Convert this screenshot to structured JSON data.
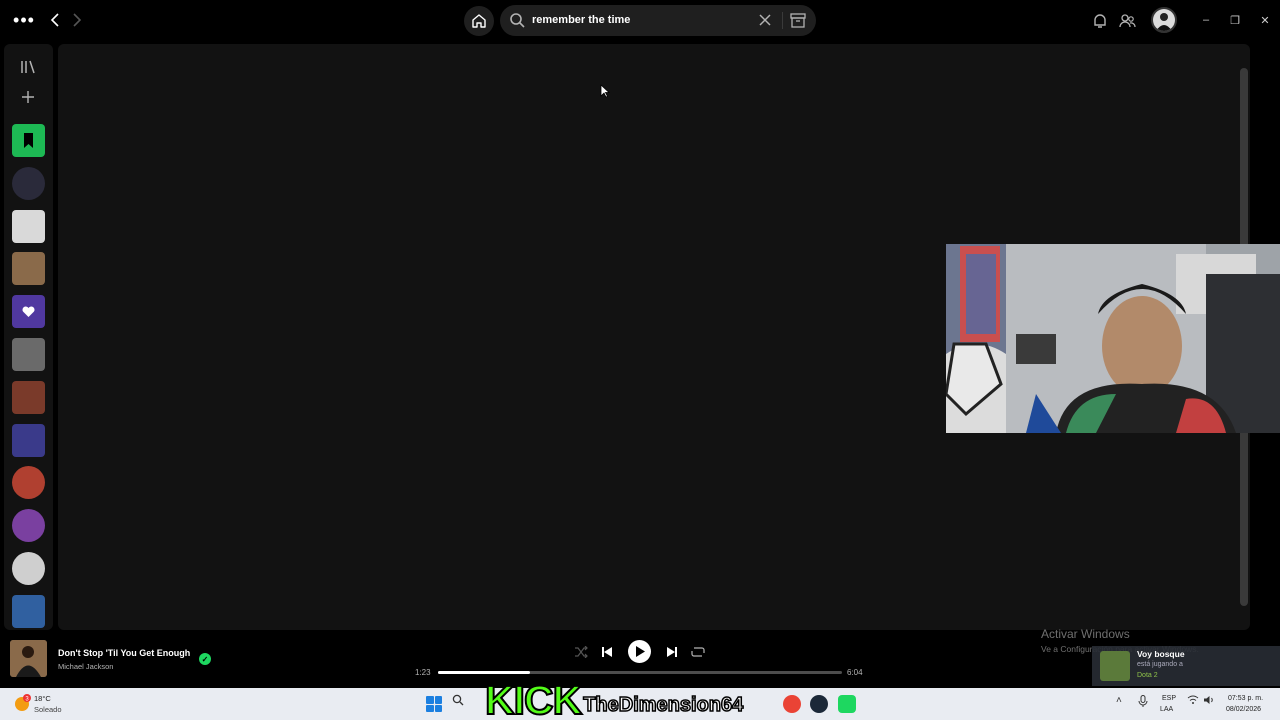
{
  "top_bar": {
    "menu_icon": "ellipsis-icon",
    "back_icon": "chevron-left-icon",
    "forward_icon": "chevron-right-icon",
    "home_icon": "home-icon",
    "search": {
      "value": "remember the time",
      "icon": "search-icon",
      "clear_icon": "close-icon",
      "browse_icon": "browse-icon"
    },
    "notifications_icon": "bell-icon",
    "friends_icon": "friends-icon",
    "window_controls": {
      "minimize": "–",
      "restore": "❐",
      "close": "✕"
    }
  },
  "sidebar": {
    "library_icon": "library-icon",
    "create_icon": "plus-icon",
    "items": [
      {
        "name": "saved-episodes",
        "color": "#1db954",
        "round": false
      },
      {
        "name": "artist-1",
        "color": "#2a2a3a",
        "round": true
      },
      {
        "name": "album-1",
        "color": "#d9d9d9",
        "round": false
      },
      {
        "name": "album-2",
        "color": "#8a6a4a",
        "round": false
      },
      {
        "name": "liked-songs",
        "color": "#5038a0",
        "round": false
      },
      {
        "name": "album-3",
        "color": "#6a6a6a",
        "round": false
      },
      {
        "name": "playlist-1",
        "color": "#7a3a2a",
        "round": false
      },
      {
        "name": "playlist-2",
        "color": "#3a3a8a",
        "round": false
      },
      {
        "name": "artist-2",
        "color": "#b04030",
        "round": true
      },
      {
        "name": "artist-3",
        "color": "#7a40a0",
        "round": true
      },
      {
        "name": "artist-4",
        "color": "#cfcfcf",
        "round": true
      },
      {
        "name": "playlist-3",
        "color": "#3060a0",
        "round": false
      }
    ]
  },
  "now_playing": {
    "title": "Don't Stop 'Til You Get Enough",
    "artist": "Michael Jackson",
    "saved_icon": "check-circle-icon",
    "elapsed": "1:23",
    "duration": "6:04",
    "progress": 0.228,
    "controls": {
      "shuffle_icon": "shuffle-icon",
      "previous_icon": "skip-back-icon",
      "play_icon": "play-icon",
      "next_icon": "skip-forward-icon",
      "repeat_icon": "repeat-icon"
    }
  },
  "watermark": {
    "line1": "Activar Windows",
    "line2": "Ve a Configuración para activar Windows."
  },
  "toast": {
    "name": "Voy bosque",
    "status": "está jugando a",
    "game": "Dota 2"
  },
  "overlay": {
    "brand": "KICK",
    "channel": "TheDimension64"
  },
  "taskbar": {
    "weather_temp": "18°C",
    "weather_cond": "Soleado",
    "weather_badge": "3",
    "lang": "ESP",
    "layout": "LAA",
    "time": "07:53 p. m.",
    "date": "08/02/2026"
  }
}
